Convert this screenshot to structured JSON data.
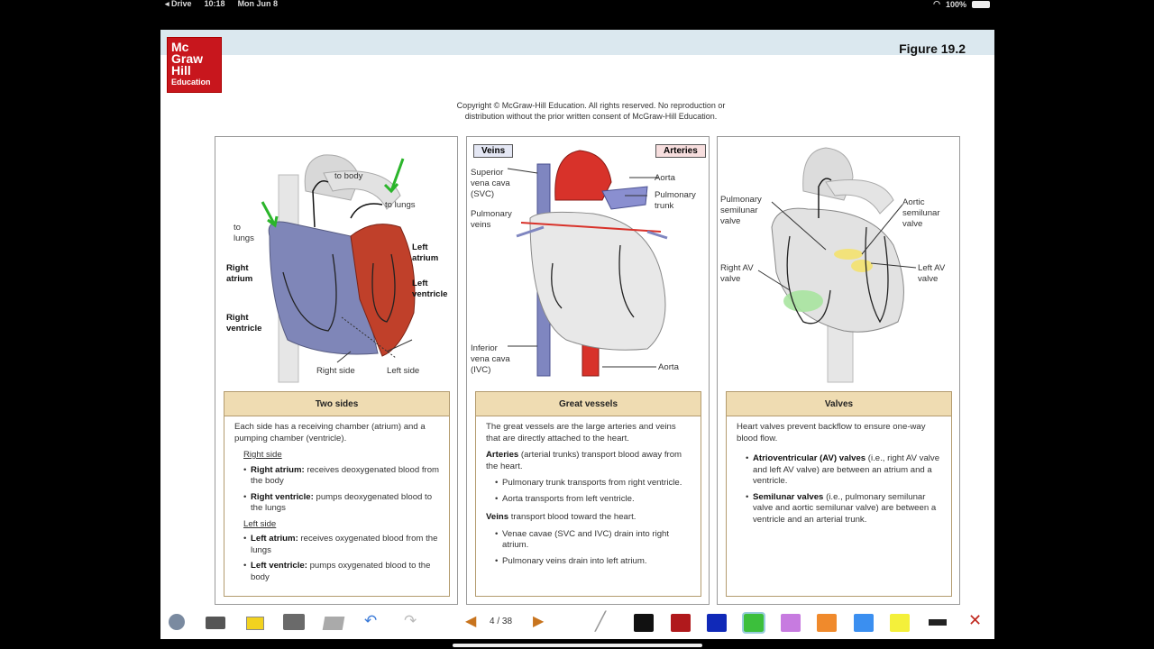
{
  "status_bar": {
    "app": "◂ Drive",
    "time": "10:18",
    "date": "Mon Jun 8",
    "battery": "100%"
  },
  "header": {
    "logo": {
      "line1": "Mc",
      "line2": "Graw",
      "line3": "Hill",
      "line4": "Education"
    },
    "figure": "Figure 19.2",
    "copyright_line1": "Copyright © McGraw-Hill Education.  All rights reserved. No reproduction or",
    "copyright_line2": "distribution without the prior written consent of  McGraw-Hill Education."
  },
  "panel1": {
    "labels": {
      "to_body": "to body",
      "to_lungs_top": "to lungs",
      "to": "to",
      "lungs": "lungs",
      "right_atrium1": "Right",
      "right_atrium2": "atrium",
      "right_ventricle1": "Right",
      "right_ventricle2": "ventricle",
      "left_atrium1": "Left",
      "left_atrium2": "atrium",
      "left_ventricle1": "Left",
      "left_ventricle2": "ventricle",
      "right_side": "Right side",
      "left_side": "Left side"
    },
    "title": "Two sides",
    "intro": "Each side has a receiving chamber (atrium) and a pumping chamber (ventricle).",
    "right_heading": "Right side",
    "right_items": [
      {
        "term": "Right atrium:",
        "text": " receives deoxygenated blood from the body"
      },
      {
        "term": "Right ventricle:",
        "text": " pumps deoxygenated blood to the lungs"
      }
    ],
    "left_heading": "Left side",
    "left_items": [
      {
        "term": "Left atrium:",
        "text": " receives oxygenated blood from the lungs"
      },
      {
        "term": "Left ventricle:",
        "text": " pumps oxygenated blood to the body"
      }
    ]
  },
  "panel2": {
    "tags": {
      "veins": "Veins",
      "arteries": "Arteries"
    },
    "labels": {
      "svc1": "Superior",
      "svc2": "vena cava",
      "svc3": "(SVC)",
      "pv1": "Pulmonary",
      "pv2": "veins",
      "ivc1": "Inferior",
      "ivc2": "vena cava",
      "ivc3": "(IVC)",
      "aorta_top": "Aorta",
      "pt1": "Pulmonary",
      "pt2": "trunk",
      "aorta_bottom": "Aorta"
    },
    "title": "Great vessels",
    "intro": "The great vessels are the large arteries and veins that are directly attached to the heart.",
    "arteries_term": "Arteries",
    "arteries_text": " (arterial trunks) transport blood away from the heart.",
    "arteries_items": [
      "Pulmonary trunk transports from right ventricle.",
      "Aorta transports from left ventricle."
    ],
    "veins_term": "Veins",
    "veins_text": " transport blood toward the heart.",
    "veins_items": [
      "Venae cavae (SVC and IVC) drain into right atrium.",
      "Pulmonary veins drain into left atrium."
    ]
  },
  "panel3": {
    "labels": {
      "psv1": "Pulmonary",
      "psv2": "semilunar",
      "psv3": "valve",
      "asv1": "Aortic",
      "asv2": "semilunar",
      "asv3": "valve",
      "rav1": "Right AV",
      "rav2": "valve",
      "lav1": "Left AV",
      "lav2": "valve"
    },
    "title": "Valves",
    "intro": "Heart valves prevent backflow to ensure one-way blood flow.",
    "items": [
      {
        "term": "Atrioventricular (AV) valves",
        "text": " (i.e., right AV valve and left AV valve) are between an atrium and a ventricle."
      },
      {
        "term": "Semilunar valves",
        "text": " (i.e., pulmonary semilunar valve and aortic semilunar valve) are between a ventricle and an arterial trunk."
      }
    ]
  },
  "toolbar": {
    "page": "4 / 38",
    "colors": [
      "#111111",
      "#b0191c",
      "#1029b8",
      "#3cbf3c",
      "#c77be0",
      "#f08a2c",
      "#3b8ff0",
      "#f4f03a"
    ]
  }
}
